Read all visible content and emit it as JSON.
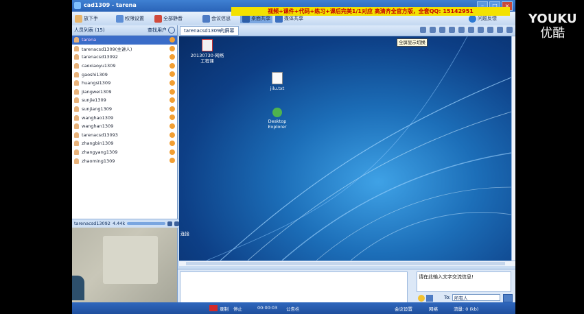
{
  "window": {
    "title": "cad1309 - tarena"
  },
  "toolbar": {
    "raise_hand": "放下手",
    "permissions": "权限设置",
    "mute_all": "全部静音",
    "meeting_info": "会议信息",
    "desktop_share": "桌面共享",
    "media_share": "媒体共享",
    "feedback": "问题反馈"
  },
  "banner": {
    "text": "视频+课件+代码+练习+课后完美1/1对应 高清齐全官方版，全套QQ: 15142951"
  },
  "user_list": {
    "title": "人员列表 (15)",
    "find": "查找用户",
    "users": [
      {
        "name": "tarena",
        "selected": true
      },
      {
        "name": "tarenacsd1309(主讲人)"
      },
      {
        "name": "tarenacsd13092"
      },
      {
        "name": "caoxiaoyu1309"
      },
      {
        "name": "gaoshi1309"
      },
      {
        "name": "huangsi1309"
      },
      {
        "name": "jiangwei1309"
      },
      {
        "name": "sunjie1309"
      },
      {
        "name": "sunjiang1309"
      },
      {
        "name": "wanghao1309"
      },
      {
        "name": "wanghan1309"
      },
      {
        "name": "tarenacsd13093"
      },
      {
        "name": "zhangbin1309"
      },
      {
        "name": "zhangyang1309"
      },
      {
        "name": "zhaoming1309"
      }
    ]
  },
  "video_bar": {
    "user": "tarenacsd13092",
    "rate": "4.44k"
  },
  "share": {
    "tab": "tarenacsd1309的屏幕",
    "tooltip": "全屏显示切换",
    "icons": [
      {
        "label": "20130730-网络工程课"
      },
      {
        "label": "jilu.txt"
      },
      {
        "label": "Desktop Explorer"
      }
    ],
    "side_label": "连接"
  },
  "chat": {
    "input_placeholder": "请在此输入文字交流信息!",
    "to_label": "To:",
    "recipient": "所有人"
  },
  "statusbar": {
    "record": "录制",
    "stop": "停止",
    "time": "00:00:03",
    "notice": "公告栏",
    "meeting_settings": "会议设置",
    "network": "网络",
    "traffic": "流量: 0 (kb)"
  },
  "watermark": {
    "top": "YOUKU",
    "bottom": "优酷"
  }
}
